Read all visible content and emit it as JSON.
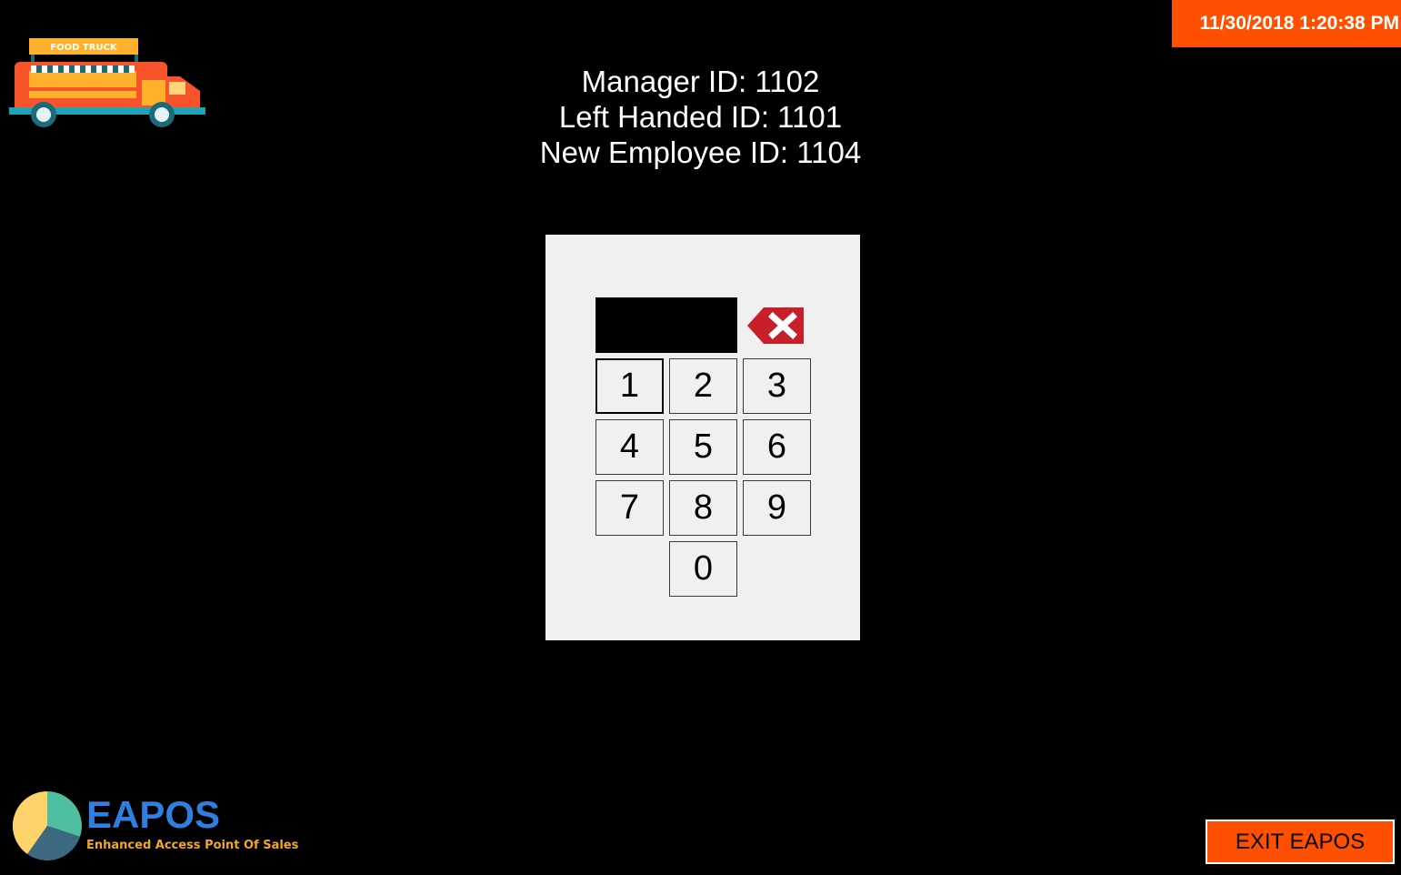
{
  "header": {
    "logo_sign_text": "FOOD TRUCK",
    "datetime": "11/30/2018 1:20:38 PM"
  },
  "id_info": {
    "lines": [
      "Manager ID: 1102",
      "Left Handed ID: 1101",
      "New Employee ID: 1104"
    ]
  },
  "keypad": {
    "pin_value": "",
    "backspace_icon": "backspace-x-icon",
    "keys": [
      "1",
      "2",
      "3",
      "4",
      "5",
      "6",
      "7",
      "8",
      "9",
      "0"
    ],
    "focused_key": "1"
  },
  "brand": {
    "name": "EAPOS",
    "tagline": "Enhanced Access Point Of Sales"
  },
  "footer": {
    "exit_label": "EXIT EAPOS"
  },
  "colors": {
    "background": "#000000",
    "accent_orange": "#ff4f00",
    "panel": "#f0f0f0",
    "backspace_red": "#c8202a",
    "brand_blue": "#2f7fe0",
    "tagline_orange": "#f5a623"
  }
}
